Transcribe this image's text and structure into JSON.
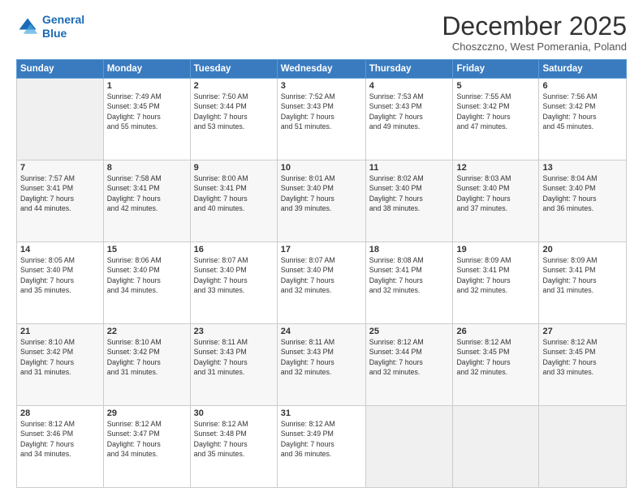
{
  "logo": {
    "line1": "General",
    "line2": "Blue"
  },
  "title": "December 2025",
  "subtitle": "Choszczno, West Pomerania, Poland",
  "days_header": [
    "Sunday",
    "Monday",
    "Tuesday",
    "Wednesday",
    "Thursday",
    "Friday",
    "Saturday"
  ],
  "weeks": [
    [
      {
        "day": "",
        "info": ""
      },
      {
        "day": "1",
        "info": "Sunrise: 7:49 AM\nSunset: 3:45 PM\nDaylight: 7 hours\nand 55 minutes."
      },
      {
        "day": "2",
        "info": "Sunrise: 7:50 AM\nSunset: 3:44 PM\nDaylight: 7 hours\nand 53 minutes."
      },
      {
        "day": "3",
        "info": "Sunrise: 7:52 AM\nSunset: 3:43 PM\nDaylight: 7 hours\nand 51 minutes."
      },
      {
        "day": "4",
        "info": "Sunrise: 7:53 AM\nSunset: 3:43 PM\nDaylight: 7 hours\nand 49 minutes."
      },
      {
        "day": "5",
        "info": "Sunrise: 7:55 AM\nSunset: 3:42 PM\nDaylight: 7 hours\nand 47 minutes."
      },
      {
        "day": "6",
        "info": "Sunrise: 7:56 AM\nSunset: 3:42 PM\nDaylight: 7 hours\nand 45 minutes."
      }
    ],
    [
      {
        "day": "7",
        "info": "Sunrise: 7:57 AM\nSunset: 3:41 PM\nDaylight: 7 hours\nand 44 minutes."
      },
      {
        "day": "8",
        "info": "Sunrise: 7:58 AM\nSunset: 3:41 PM\nDaylight: 7 hours\nand 42 minutes."
      },
      {
        "day": "9",
        "info": "Sunrise: 8:00 AM\nSunset: 3:41 PM\nDaylight: 7 hours\nand 40 minutes."
      },
      {
        "day": "10",
        "info": "Sunrise: 8:01 AM\nSunset: 3:40 PM\nDaylight: 7 hours\nand 39 minutes."
      },
      {
        "day": "11",
        "info": "Sunrise: 8:02 AM\nSunset: 3:40 PM\nDaylight: 7 hours\nand 38 minutes."
      },
      {
        "day": "12",
        "info": "Sunrise: 8:03 AM\nSunset: 3:40 PM\nDaylight: 7 hours\nand 37 minutes."
      },
      {
        "day": "13",
        "info": "Sunrise: 8:04 AM\nSunset: 3:40 PM\nDaylight: 7 hours\nand 36 minutes."
      }
    ],
    [
      {
        "day": "14",
        "info": "Sunrise: 8:05 AM\nSunset: 3:40 PM\nDaylight: 7 hours\nand 35 minutes."
      },
      {
        "day": "15",
        "info": "Sunrise: 8:06 AM\nSunset: 3:40 PM\nDaylight: 7 hours\nand 34 minutes."
      },
      {
        "day": "16",
        "info": "Sunrise: 8:07 AM\nSunset: 3:40 PM\nDaylight: 7 hours\nand 33 minutes."
      },
      {
        "day": "17",
        "info": "Sunrise: 8:07 AM\nSunset: 3:40 PM\nDaylight: 7 hours\nand 32 minutes."
      },
      {
        "day": "18",
        "info": "Sunrise: 8:08 AM\nSunset: 3:41 PM\nDaylight: 7 hours\nand 32 minutes."
      },
      {
        "day": "19",
        "info": "Sunrise: 8:09 AM\nSunset: 3:41 PM\nDaylight: 7 hours\nand 32 minutes."
      },
      {
        "day": "20",
        "info": "Sunrise: 8:09 AM\nSunset: 3:41 PM\nDaylight: 7 hours\nand 31 minutes."
      }
    ],
    [
      {
        "day": "21",
        "info": "Sunrise: 8:10 AM\nSunset: 3:42 PM\nDaylight: 7 hours\nand 31 minutes."
      },
      {
        "day": "22",
        "info": "Sunrise: 8:10 AM\nSunset: 3:42 PM\nDaylight: 7 hours\nand 31 minutes."
      },
      {
        "day": "23",
        "info": "Sunrise: 8:11 AM\nSunset: 3:43 PM\nDaylight: 7 hours\nand 31 minutes."
      },
      {
        "day": "24",
        "info": "Sunrise: 8:11 AM\nSunset: 3:43 PM\nDaylight: 7 hours\nand 32 minutes."
      },
      {
        "day": "25",
        "info": "Sunrise: 8:12 AM\nSunset: 3:44 PM\nDaylight: 7 hours\nand 32 minutes."
      },
      {
        "day": "26",
        "info": "Sunrise: 8:12 AM\nSunset: 3:45 PM\nDaylight: 7 hours\nand 32 minutes."
      },
      {
        "day": "27",
        "info": "Sunrise: 8:12 AM\nSunset: 3:45 PM\nDaylight: 7 hours\nand 33 minutes."
      }
    ],
    [
      {
        "day": "28",
        "info": "Sunrise: 8:12 AM\nSunset: 3:46 PM\nDaylight: 7 hours\nand 34 minutes."
      },
      {
        "day": "29",
        "info": "Sunrise: 8:12 AM\nSunset: 3:47 PM\nDaylight: 7 hours\nand 34 minutes."
      },
      {
        "day": "30",
        "info": "Sunrise: 8:12 AM\nSunset: 3:48 PM\nDaylight: 7 hours\nand 35 minutes."
      },
      {
        "day": "31",
        "info": "Sunrise: 8:12 AM\nSunset: 3:49 PM\nDaylight: 7 hours\nand 36 minutes."
      },
      {
        "day": "",
        "info": ""
      },
      {
        "day": "",
        "info": ""
      },
      {
        "day": "",
        "info": ""
      }
    ]
  ]
}
